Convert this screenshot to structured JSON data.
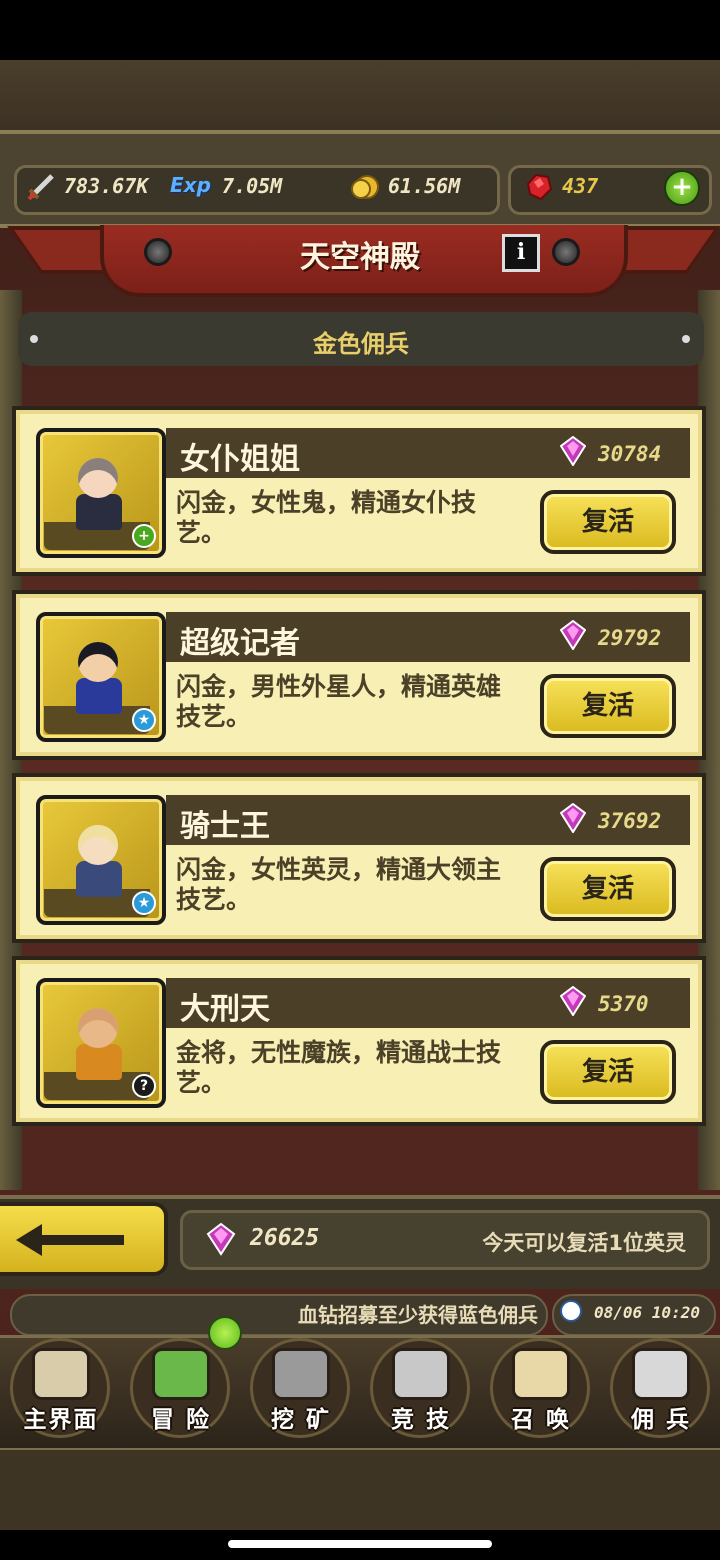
{
  "resources": {
    "power": "783.67K",
    "exp_icon_text": "Exp",
    "exp": "7.05M",
    "gold": "61.56M",
    "rubies": "437",
    "icons": {
      "power": "sword-icon",
      "gold": "coin-icon",
      "ruby": "ruby-icon",
      "add": "plus-icon"
    }
  },
  "header": {
    "title": "天空神殿",
    "info_label": "i"
  },
  "section": {
    "title": "金色佣兵"
  },
  "heroes": [
    {
      "name": "女仆姐姐",
      "price": "30784",
      "desc": "闪金，女性鬼，精通女仆技艺。",
      "button": "复活",
      "badge": "+",
      "badge_color": "#4aa81e",
      "hair": "#8a7f7a",
      "outfit": "#2a2d40",
      "skin": "#f5d7c0"
    },
    {
      "name": "超级记者",
      "price": "29792",
      "desc": "闪金，男性外星人，精通英雄技艺。",
      "button": "复活",
      "badge": "★",
      "badge_color": "#2a9ad8",
      "hair": "#1a1a22",
      "outfit": "#2a3a9a",
      "skin": "#f3cfa8"
    },
    {
      "name": "骑士王",
      "price": "37692",
      "desc": "闪金，女性英灵，精通大领主技艺。",
      "button": "复活",
      "badge": "★",
      "badge_color": "#2a9ad8",
      "hair": "#f0e0a0",
      "outfit": "#3a4a7a",
      "skin": "#f5ddc0"
    },
    {
      "name": "大刑天",
      "price": "5370",
      "desc": "金将，无性魔族，精通战士技艺。",
      "button": "复活",
      "badge": "?",
      "badge_color": "#1a1a1a",
      "hair": "#d8a070",
      "outfit": "#d88a20",
      "skin": "#e8b888"
    }
  ],
  "bottom": {
    "gem_count": "26625",
    "revive_note": "今天可以复活1位英灵",
    "marquee": "血钻招募至少获得蓝色佣兵",
    "datetime": "08/06 10:20"
  },
  "nav": [
    {
      "label": "主界面",
      "icon": "map-scroll-icon",
      "color": "#d8ccaa"
    },
    {
      "label": "冒 险",
      "icon": "island-icon",
      "color": "#6ab84a"
    },
    {
      "label": "挖 矿",
      "icon": "pickaxe-icon",
      "color": "#9a9a9a"
    },
    {
      "label": "竞 技",
      "icon": "crossed-swords-icon",
      "color": "#c8c8c8"
    },
    {
      "label": "召 唤",
      "icon": "scroll-icon",
      "color": "#e8d8a8"
    },
    {
      "label": "佣 兵",
      "icon": "tent-icon",
      "color": "#d8d8d8"
    }
  ],
  "colors": {
    "accent_gold": "#e8c74a",
    "card_bg": "#f7efb4",
    "banner_red": "#9a2c22"
  }
}
